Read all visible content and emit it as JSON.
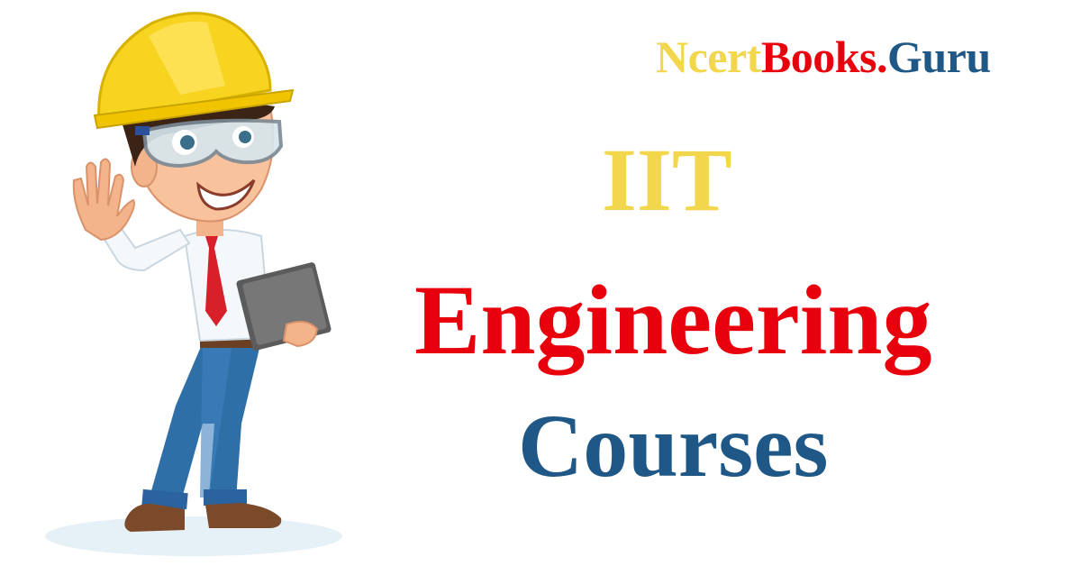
{
  "brand": {
    "part1": "Ncert",
    "part2": "Books.",
    "part3": "Guru"
  },
  "headline": {
    "line1": "IIT",
    "line2": "Engineering",
    "line3": "Courses"
  },
  "colors": {
    "yellow": "#f2d64b",
    "red": "#e8000c",
    "blue": "#1f5887",
    "background": "#ffffff"
  },
  "illustration": {
    "name": "engineer-character"
  }
}
